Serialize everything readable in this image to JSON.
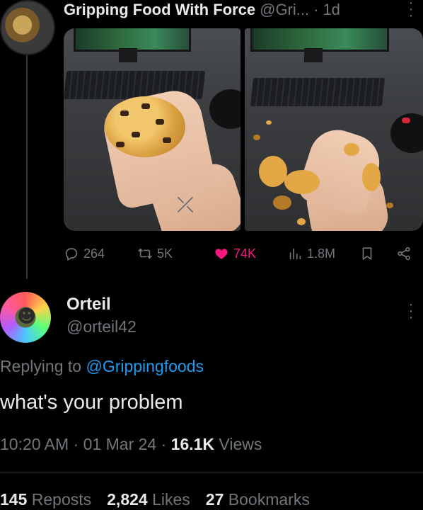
{
  "parent_tweet": {
    "author_name": "Gripping Food With Force",
    "handle": "@Gri...",
    "separator": "·",
    "time": "1d",
    "actions": {
      "replies": "264",
      "reposts": "5K",
      "likes": "74K",
      "views": "1.8M"
    }
  },
  "reply_tweet": {
    "author_name": "Orteil",
    "handle": "@orteil42",
    "replying_prefix": "Replying to",
    "replying_to": "@Grippingfoods",
    "text": "what's your problem",
    "time": "10:20 AM",
    "dot1": "·",
    "date": "01 Mar 24",
    "dot2": "·",
    "views_count": "16.1K",
    "views_label": "Views",
    "reposts_count": "145",
    "reposts_label": "Reposts",
    "likes_count": "2,824",
    "likes_label": "Likes",
    "bookmarks_count": "27",
    "bookmarks_label": "Bookmarks"
  },
  "colors": {
    "background": "#000000",
    "text": "#e7e9ea",
    "muted": "#71767b",
    "link": "#1d9bf0",
    "like": "#f91880"
  }
}
